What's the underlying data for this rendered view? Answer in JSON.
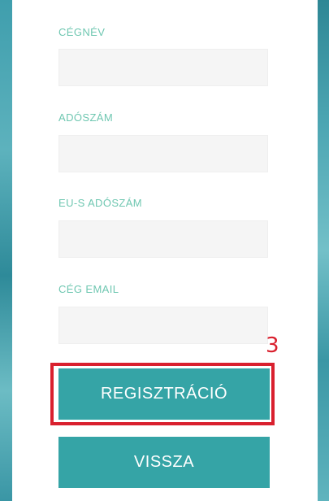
{
  "form": {
    "fields": [
      {
        "label": "CÉGNÉV",
        "value": "",
        "placeholder": ""
      },
      {
        "label": "ADÓSZÁM",
        "value": "",
        "placeholder": ""
      },
      {
        "label": "EU-S ADÓSZÁM",
        "value": "",
        "placeholder": ""
      },
      {
        "label": "CÉG EMAIL",
        "value": "",
        "placeholder": ""
      }
    ],
    "register_label": "REGISZTRÁCIÓ",
    "back_label": "VISSZA"
  },
  "annotation": {
    "step": "3"
  },
  "colors": {
    "accent": "#35a4a6",
    "label": "#6fc7b1",
    "highlight": "#d9202e",
    "input_bg": "#f5f5f5"
  }
}
